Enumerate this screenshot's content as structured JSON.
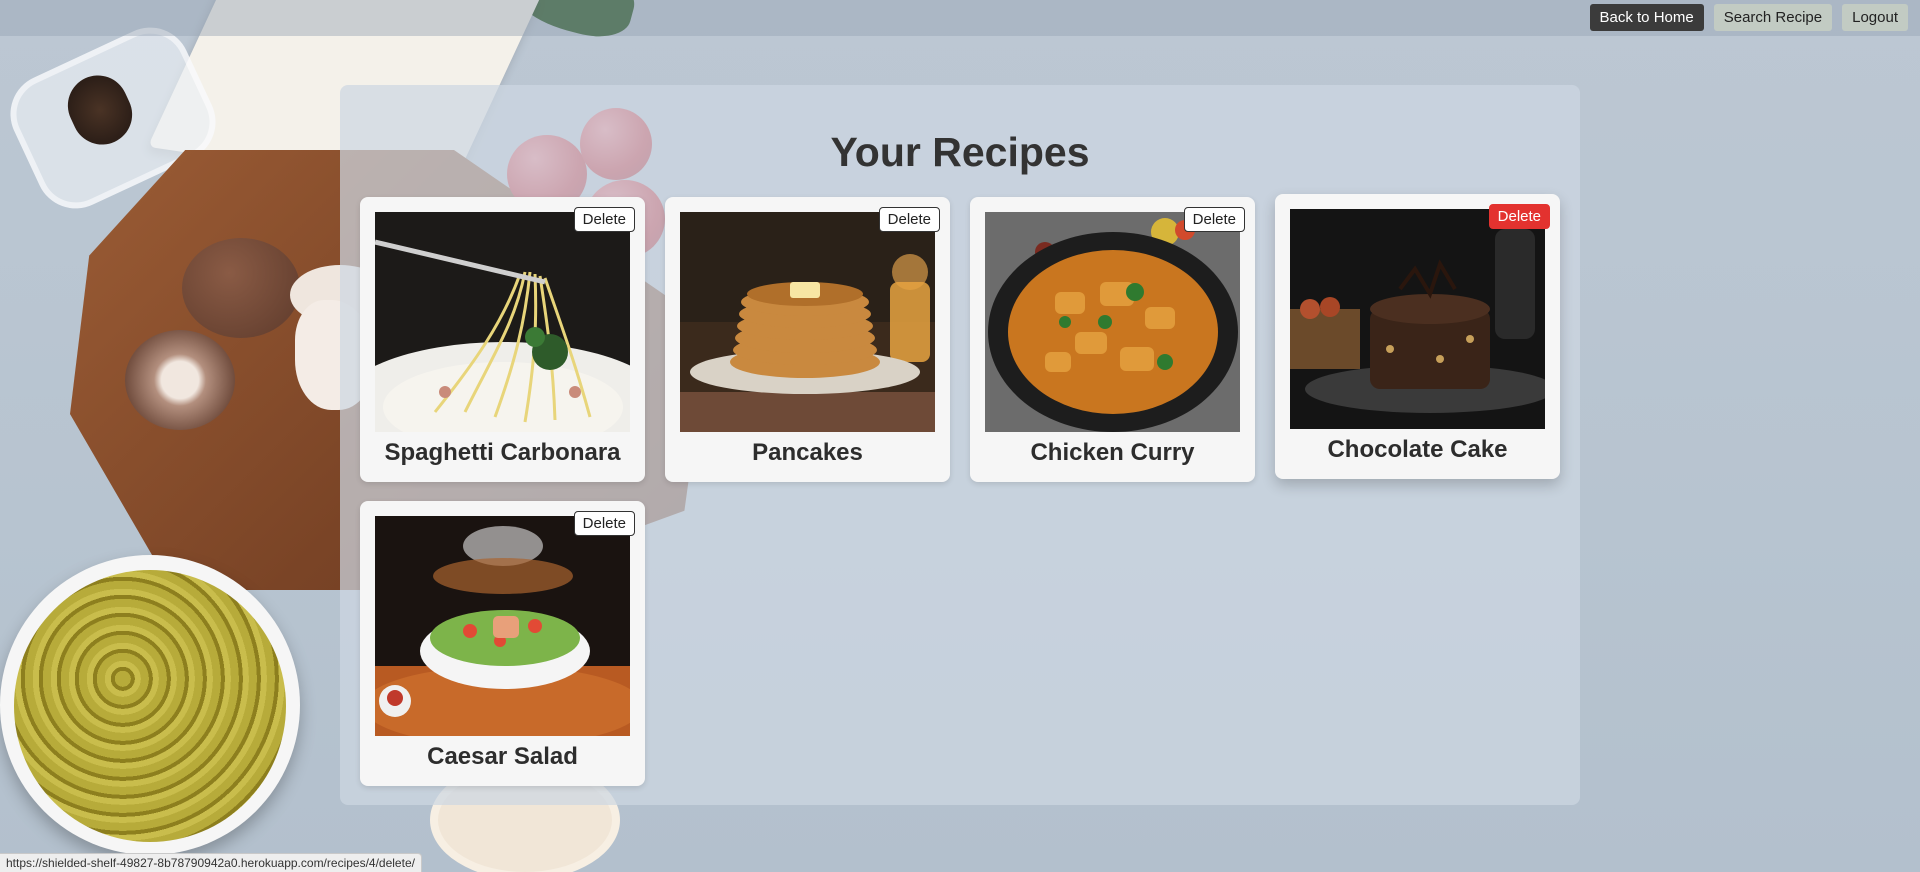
{
  "nav": {
    "back_home": "Back to Home",
    "search": "Search Recipe",
    "logout": "Logout"
  },
  "page": {
    "title": "Your Recipes"
  },
  "recipes": [
    {
      "title": "Spaghetti Carbonara",
      "delete_label": "Delete"
    },
    {
      "title": "Pancakes",
      "delete_label": "Delete"
    },
    {
      "title": "Chicken Curry",
      "delete_label": "Delete"
    },
    {
      "title": "Chocolate Cake",
      "delete_label": "Delete"
    },
    {
      "title": "Caesar Salad",
      "delete_label": "Delete"
    }
  ],
  "status": {
    "url": "https://shielded-shelf-49827-8b78790942a0.herokuapp.com/recipes/4/delete/"
  },
  "colors": {
    "delete_active": "#e3322f",
    "nav_dark": "#3b3b3b",
    "nav_light": "#c2cbc3"
  }
}
